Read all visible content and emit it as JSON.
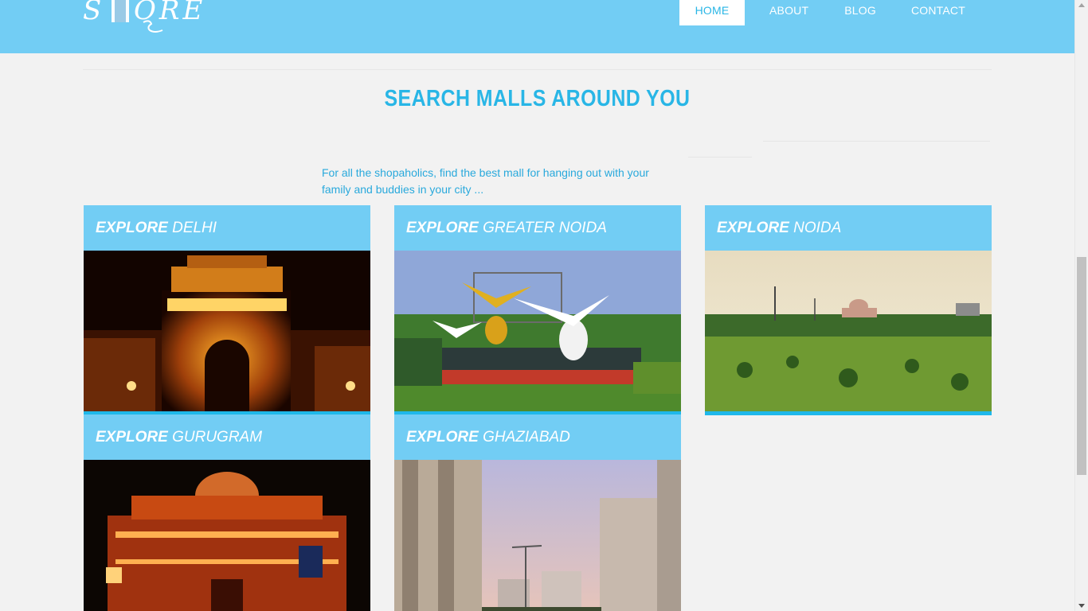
{
  "header": {
    "logo_text": "STORE",
    "nav": [
      {
        "label": "HOME",
        "active": true
      },
      {
        "label": "ABOUT",
        "active": false
      },
      {
        "label": "BLOG",
        "active": false
      },
      {
        "label": "CONTACT",
        "active": false
      }
    ]
  },
  "main": {
    "title": "SEARCH MALLS AROUND YOU",
    "tagline": "For all the shopaholics, find the best mall for hanging out with your family and buddies in your city ..."
  },
  "cards": [
    {
      "explore": "EXPLORE",
      "city": "DELHI",
      "image": "india-gate-night-image"
    },
    {
      "explore": "EXPLORE",
      "city": "GREATER NOIDA",
      "image": "angel-statues-fountain-image"
    },
    {
      "explore": "EXPLORE",
      "city": "NOIDA",
      "image": "green-park-landscape-image"
    },
    {
      "explore": "EXPLORE",
      "city": "GURUGRAM",
      "image": "kingdom-of-dreams-night-image"
    },
    {
      "explore": "EXPLORE",
      "city": "GHAZIABAD",
      "image": "highrise-buildings-image"
    }
  ],
  "colors": {
    "header_bg": "#72cdf4",
    "accent": "#29b6e6",
    "card_bar": "#1fb8ea",
    "page_bg": "#f2f2f2"
  }
}
